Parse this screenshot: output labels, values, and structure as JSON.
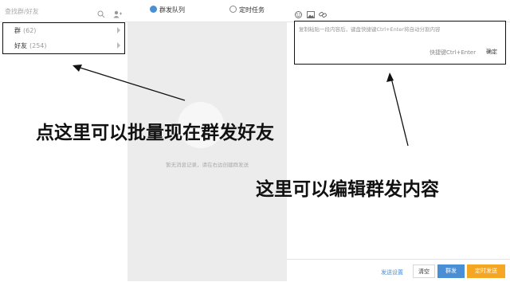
{
  "search": {
    "placeholder": "查找群/好友"
  },
  "groups": [
    {
      "name": "群",
      "count": "(62)"
    },
    {
      "name": "好友",
      "count": "(254)"
    }
  ],
  "tabs": [
    {
      "label": "群发队列"
    },
    {
      "label": "定时任务"
    }
  ],
  "queue": {
    "empty_text": "暂无消息记录，请在右边创建群发送"
  },
  "editor": {
    "placeholder": "复制粘贴一段内容后，键盘快捷键Ctrl+Enter将自动分割内容",
    "shortcut": "快捷键Ctrl+Enter",
    "confirm_label": "确定"
  },
  "annotations": {
    "left": "点这里可以批量现在群发好友",
    "right": "这里可以编辑群发内容"
  },
  "footer": {
    "settings_link": "发送设置",
    "clear_label": "清空",
    "send_label": "群发",
    "scheduled_label": "定时发送"
  },
  "colors": {
    "accent_blue": "#4a8fd6",
    "accent_orange": "#f5a623",
    "annotation_border": "#111111"
  }
}
